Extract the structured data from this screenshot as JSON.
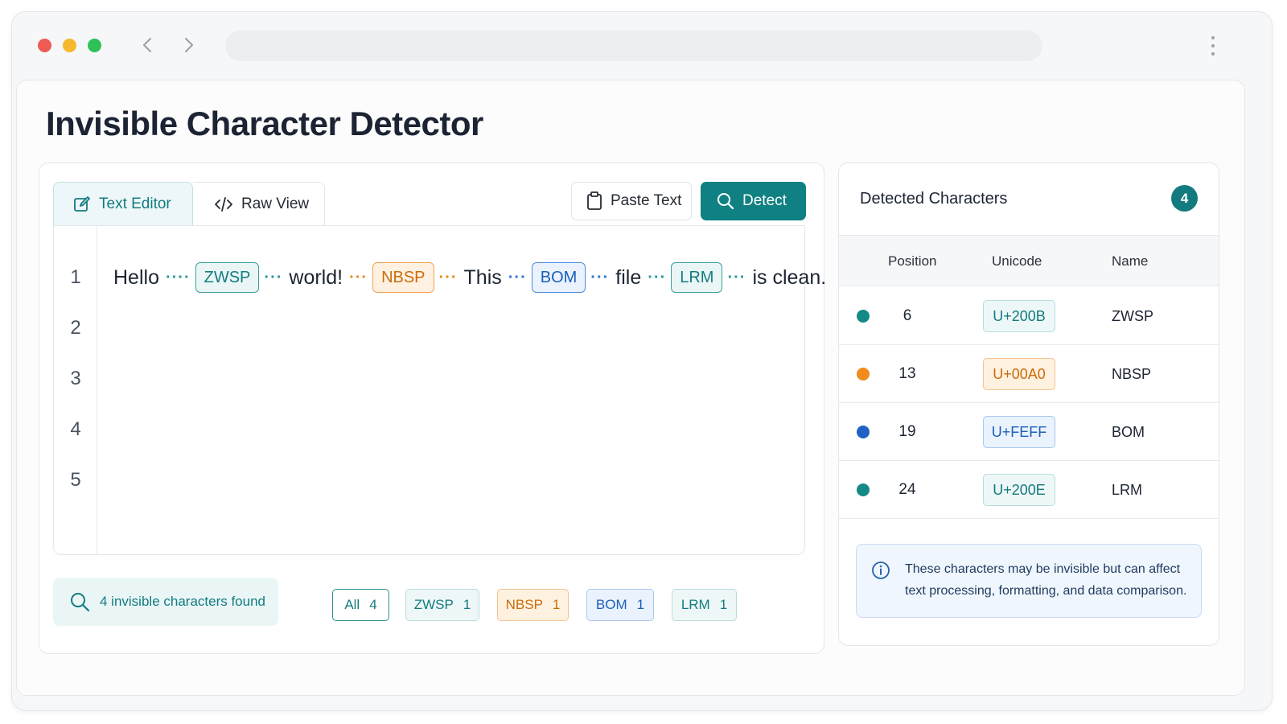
{
  "app": {
    "title": "Invisible Character Detector"
  },
  "tabs": [
    {
      "label": "Text Editor",
      "active": true,
      "icon": "edit-icon"
    },
    {
      "label": "Raw View",
      "active": false,
      "icon": "code-icon"
    }
  ],
  "toolbar": {
    "paste_label": "Paste Text",
    "detect_label": "Detect"
  },
  "editor": {
    "line_numbers": [
      "1",
      "2",
      "3",
      "4",
      "5"
    ],
    "words": [
      "Hello",
      "world!",
      "This",
      "file",
      "is clean."
    ],
    "markers": [
      "ZWSP",
      "NBSP",
      "BOM",
      "LRM"
    ]
  },
  "summary": {
    "text": "4 invisible characters found"
  },
  "filters": [
    {
      "label": "All",
      "count": "4"
    },
    {
      "label": "ZWSP",
      "count": "1"
    },
    {
      "label": "NBSP",
      "count": "1"
    },
    {
      "label": "BOM",
      "count": "1"
    },
    {
      "label": "LRM",
      "count": "1"
    }
  ],
  "panel": {
    "title": "Detected Characters",
    "count": "4",
    "columns": [
      "Position",
      "Unicode",
      "Name"
    ],
    "rows": [
      {
        "position": "6",
        "unicode": "U+200B",
        "name": "ZWSP",
        "color": "#148a86"
      },
      {
        "position": "13",
        "unicode": "U+00A0",
        "name": "NBSP",
        "color": "#f08b1c"
      },
      {
        "position": "19",
        "unicode": "U+FEFF",
        "name": "BOM",
        "color": "#1d62c4"
      },
      {
        "position": "24",
        "unicode": "U+200E",
        "name": "LRM",
        "color": "#148a86"
      }
    ],
    "info": "These characters may be invisible but can affect text processing, formatting, and data comparison."
  },
  "colors": {
    "accent": "#108182",
    "zwsp": "#137b80",
    "nbsp": "#e48a1d",
    "bom": "#1d62c4",
    "lrm": "#137b80"
  }
}
